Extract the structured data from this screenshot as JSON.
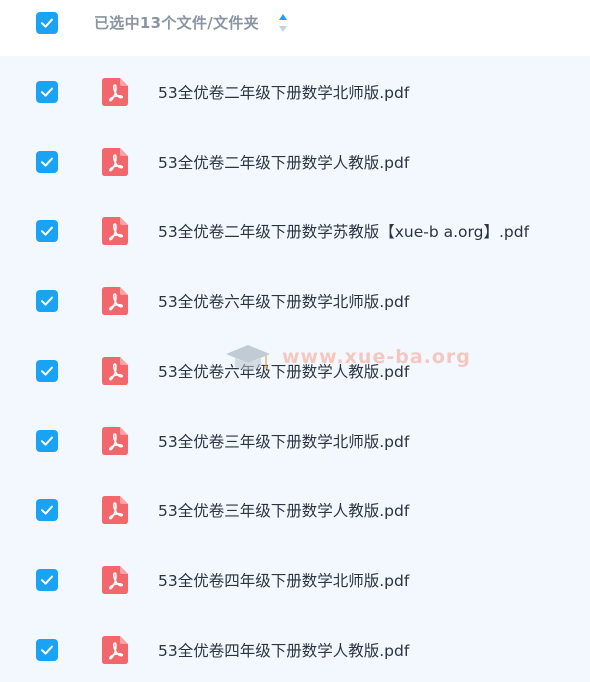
{
  "header": {
    "title": "已选中13个文件/文件夹",
    "select_all_checked": true
  },
  "colors": {
    "accent": "#1aa3f5",
    "pdf_icon": "#f1676b",
    "row_background": "#f2f8fe",
    "header_text": "#8a94a3",
    "file_text": "#2d3340",
    "watermark": "#f5a08c"
  },
  "icons": {
    "checkbox": "checkbox-checked-icon",
    "file": "pdf-file-icon",
    "sort": "sort-icon",
    "watermark": "graduation-cap-logo"
  },
  "files": [
    {
      "name": "53全优卷二年级下册数学北师版.pdf",
      "checked": true
    },
    {
      "name": "53全优卷二年级下册数学人教版.pdf",
      "checked": true
    },
    {
      "name": "53全优卷二年级下册数学苏教版【xue-b a.org】.pdf",
      "checked": true
    },
    {
      "name": "53全优卷六年级下册数学北师版.pdf",
      "checked": true
    },
    {
      "name": "53全优卷六年级下册数学人教版.pdf",
      "checked": true
    },
    {
      "name": "53全优卷三年级下册数学北师版.pdf",
      "checked": true
    },
    {
      "name": "53全优卷三年级下册数学人教版.pdf",
      "checked": true
    },
    {
      "name": "53全优卷四年级下册数学北师版.pdf",
      "checked": true
    },
    {
      "name": "53全优卷四年级下册数学人教版.pdf",
      "checked": true
    }
  ],
  "watermark": {
    "text": "www.xue-ba.org"
  }
}
